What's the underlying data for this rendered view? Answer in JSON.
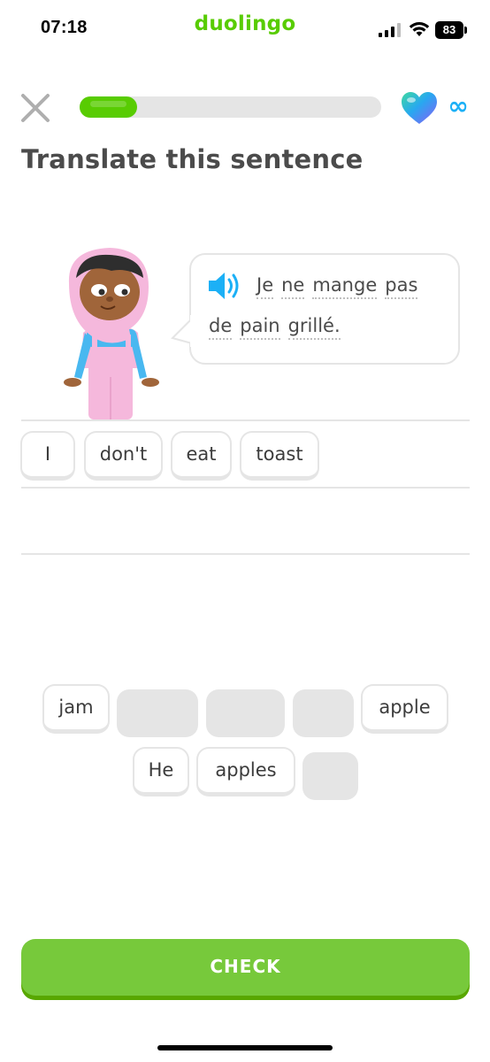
{
  "status_bar": {
    "time": "07:18",
    "brand": "duolingo",
    "battery": "83"
  },
  "header": {
    "close_icon": "close-icon",
    "progress": 0.19,
    "hearts": "∞",
    "colors": {
      "progress": "#58cc02",
      "track": "#e5e5e5",
      "infinity": "#1cb0f6"
    }
  },
  "instruction": "Translate this sentence",
  "prompt": {
    "speaker_icon": "speaker-icon",
    "line1": [
      "Je",
      "ne",
      "mange",
      "pas"
    ],
    "line2": [
      "de",
      "pain",
      "grillé."
    ]
  },
  "answer": {
    "selected_words": [
      "I",
      "don't",
      "eat",
      "toast"
    ]
  },
  "word_bank": {
    "row1": [
      "jam",
      "",
      "",
      "",
      "apple"
    ],
    "row2": [
      "He",
      "apples",
      ""
    ]
  },
  "check_button": "CHECK"
}
